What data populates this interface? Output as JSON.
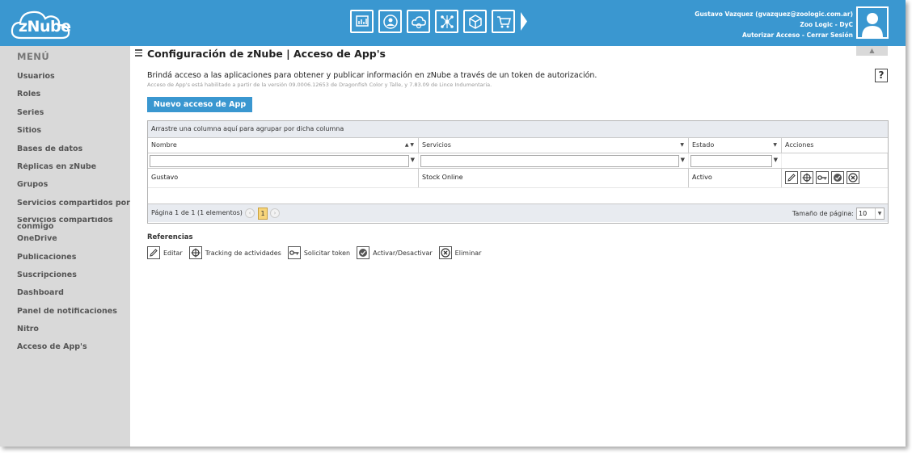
{
  "app": {
    "logo": "zNube"
  },
  "colors": {
    "primary": "#3a97d0",
    "sidebar": "#d9d9d9",
    "grid_bar": "#e8ebf0",
    "pager_current": "#f7d57a"
  },
  "header": {
    "modules": [
      "bi-chart-icon",
      "users-icon",
      "cloud-settings-icon",
      "network-icon",
      "cube-icon",
      "cart-icon"
    ],
    "user_line": "Gustavo Vazquez (gvazquez@zoologic.com.ar)",
    "company_line": "Zoo Logic - DyC",
    "authorize_link": "Autorizar Acceso",
    "separator": "-",
    "logout_link": "Cerrar Sesión"
  },
  "sidebar": {
    "title": "MENÚ",
    "items": [
      {
        "label": "Usuarios"
      },
      {
        "label": "Roles"
      },
      {
        "label": "Series"
      },
      {
        "label": "Sitios"
      },
      {
        "label": "Bases de datos"
      },
      {
        "label": "Réplicas en zNube"
      },
      {
        "label": "Grupos"
      },
      {
        "label": "Servicios compartidos por mí"
      },
      {
        "label": "Servicios compartidos conmigo"
      },
      {
        "label": "OneDrive"
      },
      {
        "label": "Publicaciones"
      },
      {
        "label": "Suscripciones"
      },
      {
        "label": "Dashboard"
      },
      {
        "label": "Panel de notificaciones"
      },
      {
        "label": "Nitro"
      },
      {
        "label": "Acceso de App's"
      }
    ]
  },
  "main": {
    "title": "Configuración de zNube | Acceso de App's",
    "collapse_label": "▲",
    "help_label": "?",
    "description": "Brindá acceso a las aplicaciones para obtener y publicar información en zNube a través de un token de autorización.",
    "subdescription": "Acceso de App's está habilitado a partir de la versión 09.0006.12653 de Dragonfish Color y Talle, y 7.83.09 de Lince Indumentaria.",
    "new_button": "Nuevo acceso de App"
  },
  "grid": {
    "group_hint": "Arrastre una columna aquí para agrupar por dicha columna",
    "columns": [
      "Nombre",
      "Servicios",
      "Estado",
      "Acciones"
    ],
    "rows": [
      {
        "nombre": "Gustavo",
        "servicios": "Stock Online",
        "estado": "Activo"
      }
    ],
    "pager": {
      "summary": "Página 1 de 1 (1 elementos)",
      "current_page": "1",
      "page_size_label": "Tamaño de página:",
      "page_size": "10"
    }
  },
  "references": {
    "title": "Referencias",
    "items": [
      {
        "icon": "edit-icon",
        "label": "Editar"
      },
      {
        "icon": "tracking-icon",
        "label": "Tracking de actividades"
      },
      {
        "icon": "key-icon",
        "label": "Solicitar token"
      },
      {
        "icon": "check-icon",
        "label": "Activar/Desactivar"
      },
      {
        "icon": "delete-icon",
        "label": "Eliminar"
      }
    ]
  }
}
